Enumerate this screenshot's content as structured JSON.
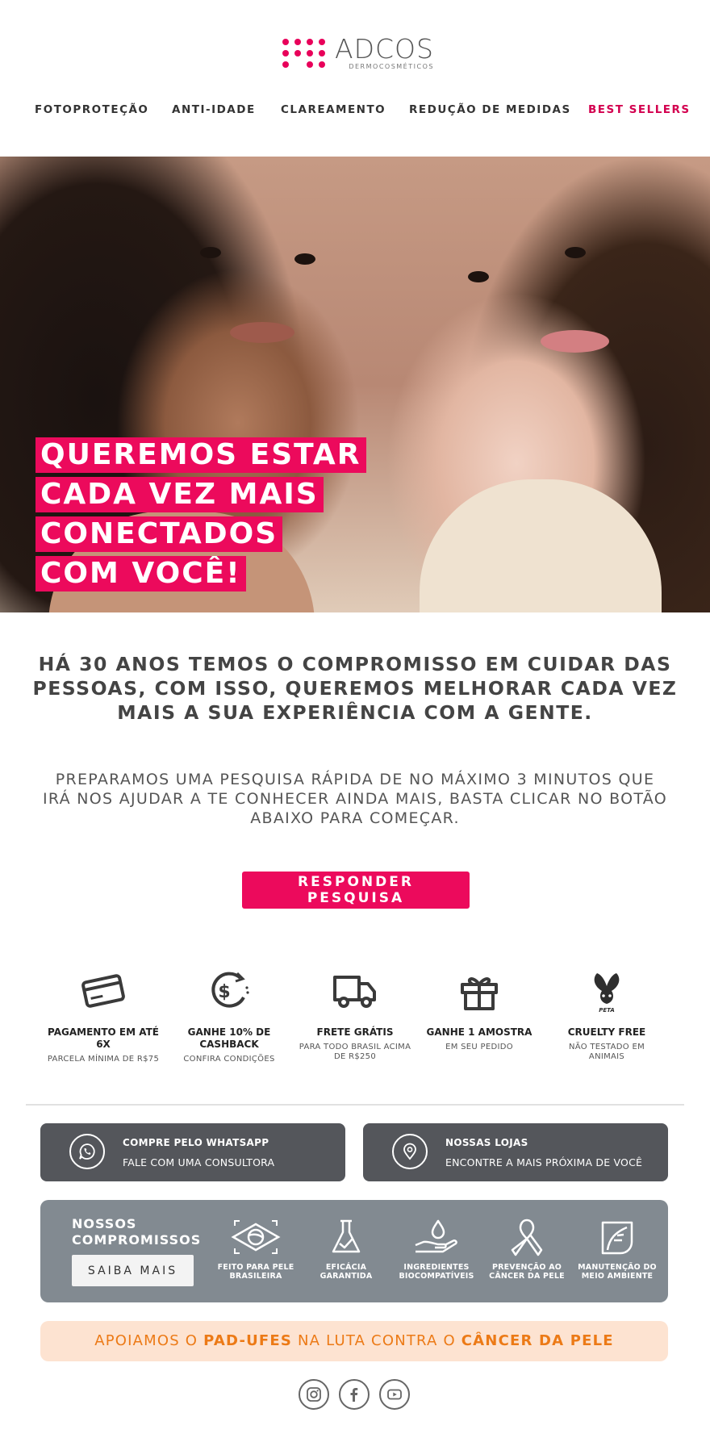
{
  "brand": {
    "name": "ADCOS",
    "tagline": "DERMOCOSMÉTICOS",
    "accent": "#ec0a5c"
  },
  "nav": [
    {
      "label": "FOTOPROTEÇÃO"
    },
    {
      "label": "ANTI-IDADE"
    },
    {
      "label": "CLAREAMENTO"
    },
    {
      "label": "REDUÇÃO DE MEDIDAS"
    },
    {
      "label": "BEST SELLERS"
    }
  ],
  "hero": {
    "lines": [
      "QUEREMOS ESTAR",
      "CADA VEZ MAIS",
      "CONECTADOS",
      "COM VOCÊ!"
    ]
  },
  "lead": "HÁ 30 ANOS TEMOS O COMPROMISSO EM CUIDAR DAS PESSOAS, COM ISSO, QUEREMOS MELHORAR CADA VEZ MAIS A SUA EXPERIÊNCIA COM A GENTE.",
  "body": "PREPARAMOS UMA PESQUISA RÁPIDA DE NO MÁXIMO 3 MINUTOS QUE IRÁ NOS AJUDAR A TE CONHECER AINDA MAIS, BASTA CLICAR NO BOTÃO ABAIXO PARA COMEÇAR.",
  "cta": "RESPONDER PESQUISA",
  "benefits": [
    {
      "icon": "credit-card-icon",
      "title": "PAGAMENTO EM ATÉ 6X",
      "sub": "PARCELA MÍNIMA DE R$75"
    },
    {
      "icon": "cashback-icon",
      "title": "GANHE 10% DE CASHBACK",
      "sub": "CONFIRA CONDIÇÕES"
    },
    {
      "icon": "truck-icon",
      "title": "FRETE GRÁTIS",
      "sub": "PARA TODO BRASIL ACIMA DE R$250"
    },
    {
      "icon": "gift-icon",
      "title": "GANHE 1 AMOSTRA",
      "sub": "EM SEU PEDIDO"
    },
    {
      "icon": "peta-bunny-icon",
      "title": "CRUELTY FREE",
      "sub": "NÃO TESTADO EM ANIMAIS",
      "badge": "PETA"
    }
  ],
  "contact": [
    {
      "icon": "whatsapp-icon",
      "title": "COMPRE PELO WHATSAPP",
      "sub": "FALE COM UMA CONSULTORA"
    },
    {
      "icon": "map-pin-icon",
      "title": "NOSSAS LOJAS",
      "sub": "ENCONTRE A MAIS PRÓXIMA DE VOCÊ"
    }
  ],
  "commitments": {
    "title_1": "NOSSOS",
    "title_2": "COMPROMISSOS",
    "button": "SAIBA MAIS",
    "items": [
      {
        "icon": "brazil-skin-icon",
        "label_1": "FEITO PARA PELE",
        "label_2": "BRASILEIRA"
      },
      {
        "icon": "flask-icon",
        "label_1": "EFICÁCIA",
        "label_2": "GARANTIDA"
      },
      {
        "icon": "drop-hand-icon",
        "label_1": "INGREDIENTES",
        "label_2": "BIOCOMPATÍVEIS"
      },
      {
        "icon": "ribbon-icon",
        "label_1": "PREVENÇÃO AO",
        "label_2": "CÂNCER DA PELE"
      },
      {
        "icon": "leaf-icon",
        "label_1": "MANUTENÇÃO DO",
        "label_2": "MEIO AMBIENTE"
      }
    ]
  },
  "support": {
    "p1": "APOIAMOS O ",
    "b1": "PAD-UFES",
    "p2": " NA LUTA CONTRA O ",
    "b2": "CÂNCER DA PELE",
    "color": "#ec7a16",
    "bg": "#fde3d1"
  },
  "social": [
    "instagram-icon",
    "facebook-icon",
    "youtube-icon"
  ]
}
